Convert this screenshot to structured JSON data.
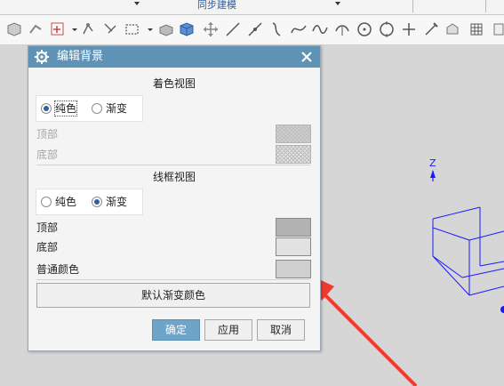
{
  "ribbon": {
    "tab_label": "同步建模"
  },
  "toolbar": {
    "icons": [
      "shape-icon",
      "shape-icon",
      "snap-icon",
      "rotate-icon",
      "rotate-icon",
      "select-box-icon",
      "box-icon",
      "cube-icon",
      "move-icon",
      "line-icon",
      "line-icon",
      "curve-icon",
      "spline-icon",
      "wave-icon",
      "arc-icon",
      "circle-icon",
      "circle-target-icon",
      "plus-icon",
      "edit-icon",
      "view-icon",
      "grid-icon"
    ]
  },
  "dialog": {
    "title": "编辑背景",
    "shaded_view": {
      "title": "着色视图",
      "solid_label": "纯色",
      "gradient_label": "渐变",
      "selected": "纯色",
      "top_label": "顶部",
      "bottom_label": "底部"
    },
    "wireframe_view": {
      "title": "线框视图",
      "solid_label": "纯色",
      "gradient_label": "渐变",
      "selected": "渐变",
      "top_label": "顶部",
      "bottom_label": "底部",
      "normal_color_label": "普通颜色"
    },
    "default_gradient_button": "默认渐变颜色",
    "ok_button": "确定",
    "apply_button": "应用",
    "cancel_button": "取消"
  },
  "viewport": {
    "axis_label": "Z"
  },
  "colors": {
    "title_bar": "#5f93b6",
    "ok_button": "#6ea4c9",
    "wireframe_top": "#b2b2b2",
    "wireframe_bottom": "#e2e2e2",
    "normal_color": "#d0d0d0",
    "annotation_arrow": "#f03a2f",
    "wireframe_lines": "#1a1aff"
  }
}
